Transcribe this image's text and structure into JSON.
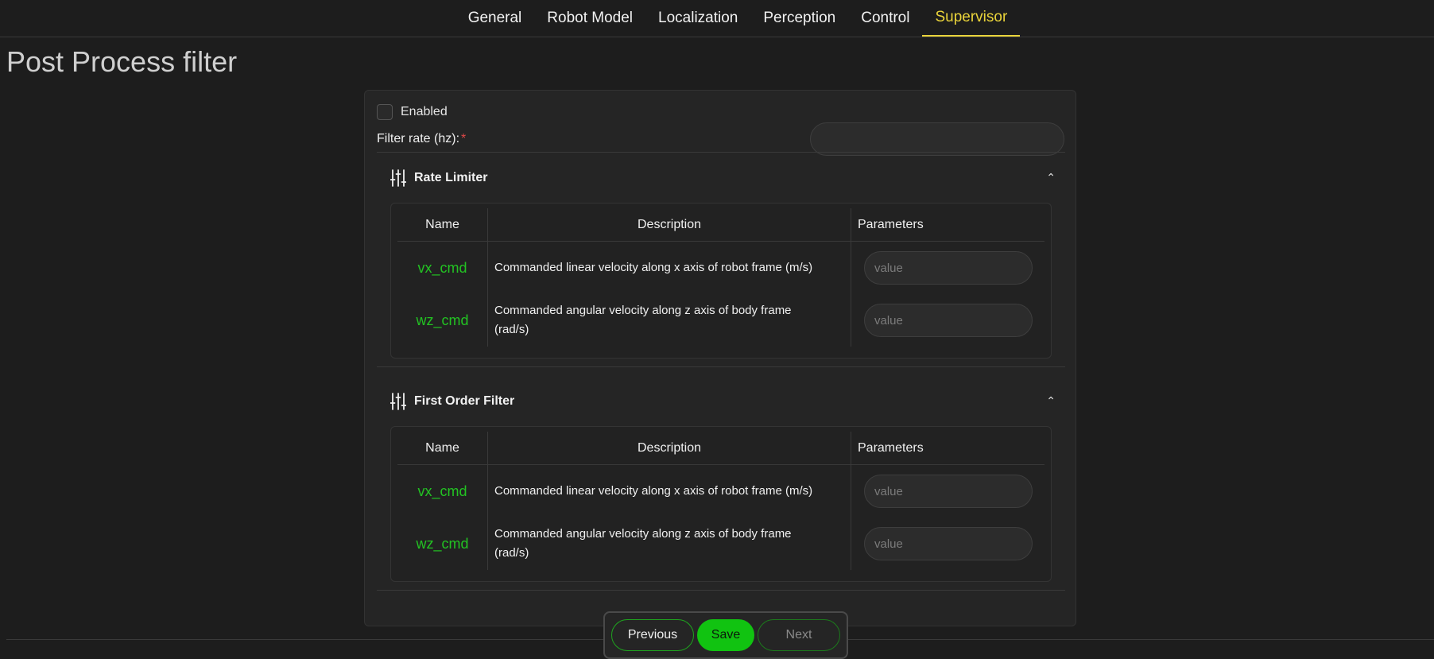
{
  "nav": {
    "tabs": [
      {
        "label": "General"
      },
      {
        "label": "Robot Model"
      },
      {
        "label": "Localization"
      },
      {
        "label": "Perception"
      },
      {
        "label": "Control"
      },
      {
        "label": "Supervisor"
      }
    ],
    "active_tab": "Supervisor"
  },
  "page": {
    "title": "Post Process filter"
  },
  "form": {
    "enabled_label": "Enabled",
    "enabled_checked": false,
    "filter_rate_label": "Filter rate (hz):",
    "required_marker": "*",
    "filter_rate_value": ""
  },
  "sections": [
    {
      "title": "Rate Limiter",
      "icon": "sliders-icon",
      "expanded": true,
      "columns": {
        "name": "Name",
        "description": "Description",
        "parameters": "Parameters"
      },
      "rows": [
        {
          "name": "vx_cmd",
          "description": "Commanded linear velocity along x axis of robot frame (m/s)",
          "placeholder": "value"
        },
        {
          "name": "wz_cmd",
          "description": "Commanded angular velocity along z axis of body frame (rad/s)",
          "placeholder": "value"
        }
      ]
    },
    {
      "title": "First Order Filter",
      "icon": "sliders-icon",
      "expanded": true,
      "columns": {
        "name": "Name",
        "description": "Description",
        "parameters": "Parameters"
      },
      "rows": [
        {
          "name": "vx_cmd",
          "description": "Commanded linear velocity along x axis of robot frame (m/s)",
          "placeholder": "value"
        },
        {
          "name": "wz_cmd",
          "description": "Commanded angular velocity along z axis of body frame (rad/s)",
          "placeholder": "value"
        }
      ]
    }
  ],
  "footer": {
    "previous_label": "Previous",
    "save_label": "Save",
    "next_label": "Next"
  },
  "colors": {
    "accent_active_tab": "#e9d33a",
    "param_name": "#22c322",
    "save_button": "#11c311",
    "required": "#e04848"
  }
}
